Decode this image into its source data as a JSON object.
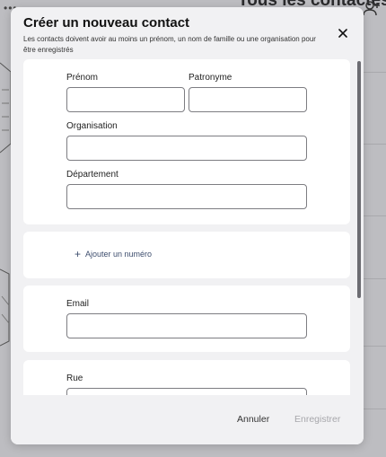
{
  "background": {
    "title": "Tous les contactes",
    "menu_icon": "ellipsis-icon",
    "add_user_icon": "add-user-icon"
  },
  "modal": {
    "title": "Créer un nouveau contact",
    "subtitle": "Les contacts doivent avoir au moins un prénom, un nom de famille ou une organisation pour être enregistrés",
    "close_icon": "close-icon"
  },
  "form": {
    "first_name_label": "Prénom",
    "first_name_value": "",
    "last_name_label": "Patronyme",
    "last_name_value": "",
    "organisation_label": "Organisation",
    "organisation_value": "",
    "department_label": "Département",
    "department_value": "",
    "add_phone_label": "Ajouter un numéro",
    "email_label": "Email",
    "email_value": "",
    "street_label": "Rue",
    "street_value": ""
  },
  "footer": {
    "cancel_label": "Annuler",
    "save_label": "Enregistrer"
  },
  "colors": {
    "save_disabled": "#a7a7ab",
    "accent_link": "#3e4e6e"
  }
}
